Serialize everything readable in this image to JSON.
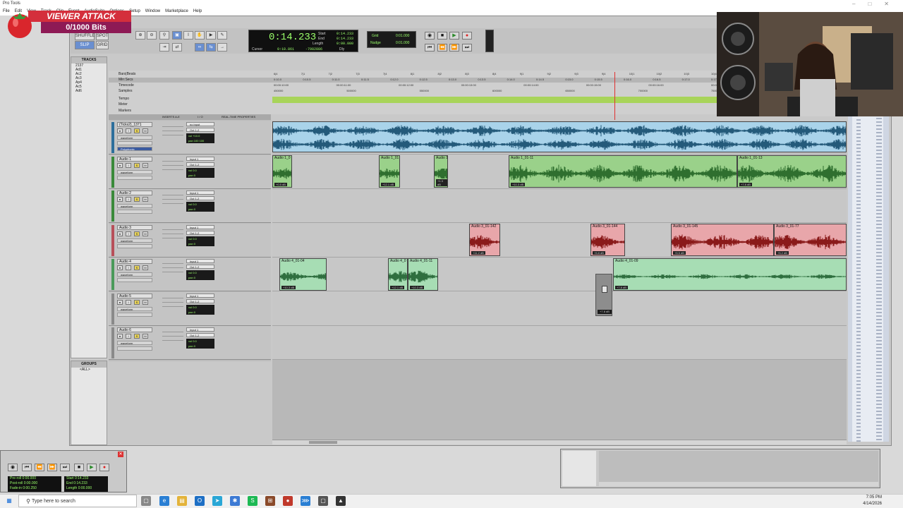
{
  "window": {
    "title": "Pro Tools"
  },
  "menu": [
    "File",
    "Edit",
    "View",
    "Track",
    "Clip",
    "Event",
    "AudioSuite",
    "Options",
    "Setup",
    "Window",
    "Marketplace",
    "Help"
  ],
  "overlay": {
    "title": "VIEWER ATTACK",
    "counter": "0/1000 Bits"
  },
  "toolbar": {
    "mode_shuffle": "SHUFFLE",
    "mode_spot": "SPOT",
    "mode_slip": "SLIP",
    "mode_grid": "GRID",
    "counter_main": "0:14.233",
    "start_label": "Start",
    "start_val": "0:14.233",
    "end_label": "End",
    "end_val": "0:14.233",
    "length_label": "Length",
    "length_val": "0:00.000",
    "cursor_label": "Cursor",
    "cursor_val": "0:18.861",
    "sample_val": "-7982886",
    "dly_label": "Dly",
    "grid_label": "Grid",
    "grid_val": "0:01.000",
    "nudge_label": "Nudge",
    "nudge_val": "0:01.000"
  },
  "panels": {
    "tracks_header": "TRACKS",
    "tracks": [
      "2137",
      "Ad1",
      "Ac2",
      "Ac3",
      "Ap4",
      "Ac5",
      "Ad6"
    ],
    "groups_header": "GROUPS",
    "groups_all": "<ALL>"
  },
  "rulers": {
    "labels": [
      "Bars|Beats",
      "Min:Secs",
      "Timecode",
      "Samples",
      "Tempo",
      "Meter",
      "Markers"
    ],
    "bars": [
      "6|4",
      "7|1",
      "7|2",
      "7|3",
      "7|4",
      "8|1",
      "8|2",
      "8|3",
      "8|4",
      "9|1",
      "9|2",
      "9|3",
      "9|4",
      "10|1",
      "10|2",
      "10|3",
      "10|4"
    ],
    "minsecs": [
      "0:10.0",
      "0:10.5",
      "0:11.0",
      "0:11.5",
      "0:12.0",
      "0:12.5",
      "0:13.0",
      "0:13.5",
      "0:14.0",
      "0:14.5",
      "0:15.0",
      "0:15.5",
      "0:16.0",
      "0:16.5",
      "0:17.0",
      "0:17.5"
    ],
    "timecode": [
      "00:00:10:00",
      "00:00:11:00",
      "00:00:12:00",
      "00:00:13:00",
      "00:00:14:00",
      "00:00:15:00",
      "00:00:16:00",
      "00:00:17:00"
    ],
    "samples": [
      "450000",
      "500000",
      "550000",
      "600000",
      "650000",
      "700000",
      "750000"
    ]
  },
  "columns": {
    "inserts": "INSERTS A-E",
    "io": "I / O",
    "rtp": "REAL-TIME PROPERTIES"
  },
  "tracks": [
    {
      "name": "(Ticks2)_1371",
      "mode": "waveform",
      "input": "no input",
      "output": "Out 1-2",
      "vol": "vol +10.0",
      "pan": "pan 100 100",
      "extra": "Polyphonic"
    },
    {
      "name": "Audio 1",
      "mode": "waveform",
      "input": "Input 1",
      "output": "Out 1-2",
      "vol": "vol 0.0",
      "pan": "pan 0"
    },
    {
      "name": "Audio 2",
      "mode": "waveform",
      "input": "Input 1",
      "output": "Out 1-2",
      "vol": "vol 0.0",
      "pan": "pan 0"
    },
    {
      "name": "Audio 3",
      "mode": "waveform",
      "input": "Input 1",
      "output": "Out 1-2",
      "vol": "vol 0.0",
      "pan": "pan 0"
    },
    {
      "name": "Audio 4",
      "mode": "waveform",
      "input": "Input 1",
      "output": "Out 1-2",
      "vol": "vol 0.0",
      "pan": "pan 0"
    },
    {
      "name": "Audio 5",
      "mode": "waveform",
      "input": "Input 1",
      "output": "Out 1-2",
      "vol": "vol 0.0",
      "pan": "pan 0"
    },
    {
      "name": "Audio 6",
      "mode": "waveform",
      "input": "Input 1",
      "output": "Out 1-2",
      "vol": "vol 0.0",
      "pan": "pan 0"
    }
  ],
  "clips": {
    "a1_1": {
      "name": "Audio 1_0",
      "gain": "+0.5 dB"
    },
    "a1_2": {
      "name": "Audio 1_01",
      "gain": "+12.1 dB"
    },
    "a1_3": {
      "name": "Audio 1",
      "gain": "+1.3 dB"
    },
    "a1_4": {
      "name": "Audio 1_01-11",
      "gain": "+10.3 dB"
    },
    "a1_5": {
      "name": "Audio 1_01-13",
      "gain": "+7.8 dB"
    },
    "a3_1": {
      "name": "Audio 3_01-142",
      "gain": "+11.2 dB"
    },
    "a3_2": {
      "name": "Audio 3_01-144",
      "gain": "+5.8 dB"
    },
    "a3_3": {
      "name": "Audio 3_01-145",
      "gain": "+5.5 dB"
    },
    "a3_4": {
      "name": "Audio 3_01-77",
      "gain": "+5.2 dB"
    },
    "a4_1": {
      "name": "Audio 4_01-04",
      "gain": "+10.3 dB"
    },
    "a4_2": {
      "name": "Audio 4_0",
      "gain": "+12.1 dB"
    },
    "a4_3": {
      "name": "Audio 4_01-11",
      "gain": "+10.3 dB"
    },
    "a4_4": {
      "name": "Audio 4_01-09",
      "gain": "+7.8 dB"
    }
  },
  "fader_popup": {
    "value": "+7.8 dB"
  },
  "transport_window": {
    "preroll_label": "Pre-roll",
    "preroll": "0:00.000",
    "postroll_label": "Post-roll",
    "postroll": "0:00.000",
    "fadein_label": "Fade-in",
    "fadein": "0:00.250",
    "start_label": "Start",
    "start": "0:14.233",
    "end_label": "End",
    "end": "0:14.233",
    "length_label": "Length",
    "length": "0:00.000"
  },
  "taskbar": {
    "search_placeholder": "Type here to search",
    "time": "7:05 PM",
    "date": "4/14/2026"
  },
  "colors": {
    "blue_clip": "#a9d3ea",
    "green_clip": "#9ad18a",
    "red_clip": "#e8a6aa",
    "mint_clip": "#a7ddb4",
    "lcd_green": "#9aff6a"
  }
}
